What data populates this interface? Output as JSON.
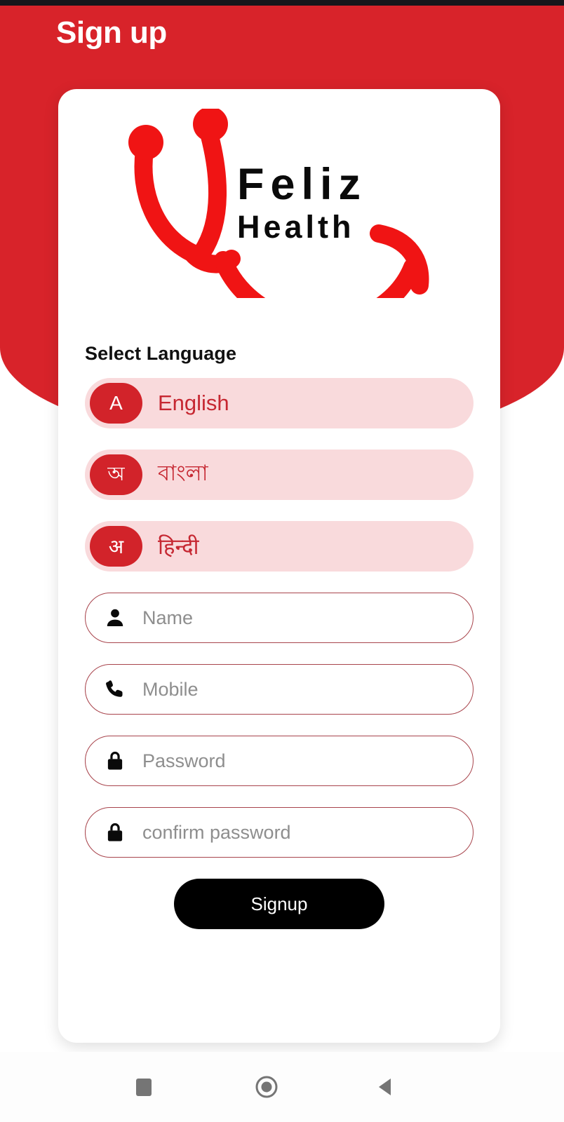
{
  "app": {
    "screen_title": "Sign up",
    "brand_name_primary": "Feliz",
    "brand_name_secondary": "Health",
    "accent_red": "#D8232A",
    "badge_red": "#D2232A",
    "pill_pink": "#F9DADC",
    "label_red": "#C62832",
    "field_border": "#A8444C",
    "placeholder_gray": "#8e8e8e",
    "button_black": "#000000"
  },
  "logo": {
    "icon_name": "stethoscope-icon",
    "color": "#F01414"
  },
  "language_section": {
    "heading": "Select Language",
    "options": [
      {
        "badge": "A",
        "label": "English",
        "code": "en"
      },
      {
        "badge": "অ",
        "label": "বাংলা",
        "code": "bn"
      },
      {
        "badge": "अ",
        "label": "हिन्दी",
        "code": "hi"
      }
    ]
  },
  "form": {
    "fields": [
      {
        "icon": "person-icon",
        "placeholder": "Name",
        "value": "",
        "type": "text"
      },
      {
        "icon": "phone-icon",
        "placeholder": "Mobile",
        "value": "",
        "type": "tel"
      },
      {
        "icon": "lock-icon",
        "placeholder": "Password",
        "value": "",
        "type": "password"
      },
      {
        "icon": "lock-icon",
        "placeholder": "confirm password",
        "value": "",
        "type": "password"
      }
    ],
    "submit_label": "Signup"
  },
  "navigation_bar": {
    "buttons": [
      {
        "name": "recents",
        "icon": "square-icon"
      },
      {
        "name": "home",
        "icon": "circle-icon"
      },
      {
        "name": "back",
        "icon": "triangle-left-icon"
      }
    ],
    "icon_color": "#757575"
  }
}
